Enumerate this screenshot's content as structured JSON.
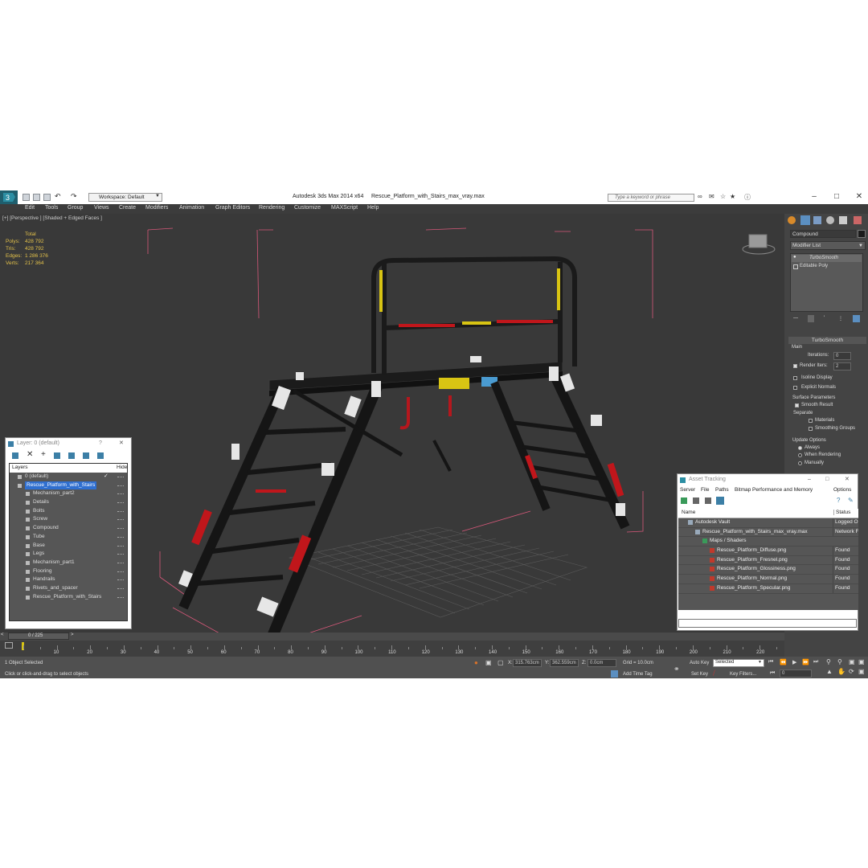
{
  "title_bar": {
    "workspace_label": "Workspace: Default",
    "app_title": "Autodesk 3ds Max  2014 x64",
    "file_name": "Rescue_Platform_with_Stairs_max_vray.max",
    "search_placeholder": "Type a keyword or phrase"
  },
  "menu": [
    "Edit",
    "Tools",
    "Group",
    "Views",
    "Create",
    "Modifiers",
    "Animation",
    "Graph Editors",
    "Rendering",
    "Customize",
    "MAXScript",
    "Help"
  ],
  "viewport": {
    "label": "[+] [Perspective ] [Shaded + Edged Faces ]",
    "stats": {
      "header": "Total",
      "rows": [
        {
          "label": "Polys:",
          "value": "428 792"
        },
        {
          "label": "Tris:",
          "value": "428 792"
        },
        {
          "label": "Edges:",
          "value": "1 286 376"
        },
        {
          "label": "Verts:",
          "value": "217 364"
        }
      ]
    }
  },
  "command_panel": {
    "object_name": "Compound",
    "modifier_list_label": "Modifier List",
    "stack": [
      "TurboSmooth",
      "Editable Poly"
    ],
    "turbosmooth": {
      "title": "TurboSmooth",
      "main_label": "Main",
      "iterations_label": "Iterations:",
      "iterations_value": "0",
      "render_iters_label": "Render Iters:",
      "render_iters_value": "2",
      "isoline_label": "Isoline Display",
      "explicit_normals_label": "Explicit Normals",
      "surface_params_label": "Surface Parameters",
      "smooth_result_label": "Smooth Result",
      "separate_label": "Separate",
      "materials_label": "Materials",
      "smoothing_groups_label": "Smoothing Groups",
      "update_options_label": "Update Options",
      "always_label": "Always",
      "when_rendering_label": "When Rendering",
      "manually_label": "Manually"
    }
  },
  "layer_window": {
    "title": "Layer: 0 (default)",
    "help": "?",
    "col_layers": "Layers",
    "col_hide": "Hide",
    "rows": [
      {
        "name": "0 (default)",
        "level": 0,
        "selected": false
      },
      {
        "name": "Rescue_Platform_with_Stairs",
        "level": 0,
        "selected": true
      },
      {
        "name": "Mechanism_part2",
        "level": 1,
        "selected": false
      },
      {
        "name": "Details",
        "level": 1,
        "selected": false
      },
      {
        "name": "Bolts",
        "level": 1,
        "selected": false
      },
      {
        "name": "Screw",
        "level": 1,
        "selected": false
      },
      {
        "name": "Compound",
        "level": 1,
        "selected": false
      },
      {
        "name": "Tube",
        "level": 1,
        "selected": false
      },
      {
        "name": "Base",
        "level": 1,
        "selected": false
      },
      {
        "name": "Legs",
        "level": 1,
        "selected": false
      },
      {
        "name": "Mechanism_part1",
        "level": 1,
        "selected": false
      },
      {
        "name": "Flooring",
        "level": 1,
        "selected": false
      },
      {
        "name": "Handrails",
        "level": 1,
        "selected": false
      },
      {
        "name": "Rivets_and_spacer",
        "level": 1,
        "selected": false
      },
      {
        "name": "Rescue_Platform_with_Stairs",
        "level": 1,
        "selected": false
      }
    ]
  },
  "asset_window": {
    "title": "Asset Tracking",
    "menu": [
      "Server",
      "File",
      "Paths",
      "Bitmap Performance and Memory",
      "Options"
    ],
    "col_name": "Name",
    "col_status": "Status",
    "rows": [
      {
        "name": "Autodesk Vault",
        "status": "Logged O",
        "level": 0
      },
      {
        "name": "Rescue_Platform_with_Stairs_max_vray.max",
        "status": "Network F",
        "level": 1
      },
      {
        "name": "Maps / Shaders",
        "status": "",
        "level": 2
      },
      {
        "name": "Rescue_Platform_Diffuse.png",
        "status": "Found",
        "level": 3
      },
      {
        "name": "Rescue_Platform_Fresnel.png",
        "status": "Found",
        "level": 3
      },
      {
        "name": "Rescue_Platform_Glossiness.png",
        "status": "Found",
        "level": 3
      },
      {
        "name": "Rescue_Platform_Normal.png",
        "status": "Found",
        "level": 3
      },
      {
        "name": "Rescue_Platform_Specular.png",
        "status": "Found",
        "level": 3
      }
    ]
  },
  "timeline": {
    "frame_label": "0 / 225",
    "ticks": [
      "10",
      "20",
      "30",
      "40",
      "50",
      "60",
      "70",
      "80",
      "90",
      "100",
      "110",
      "120",
      "130",
      "140",
      "150",
      "160",
      "170",
      "180",
      "190",
      "200",
      "210",
      "220"
    ]
  },
  "status_bar": {
    "selection": "1 Object Selected",
    "prompt": "Click or click-and-drag to select objects",
    "x_label": "X:",
    "x_value": "315.763cm",
    "y_label": "Y:",
    "y_value": "362.559cm",
    "z_label": "Z:",
    "z_value": "0.0cm",
    "grid": "Grid = 10.0cm",
    "add_time_tag": "Add Time Tag",
    "auto_key": "Auto Key",
    "selected": "Selected",
    "set_key": "Set Key",
    "key_filters": "Key Filters...",
    "frame_value": "0"
  }
}
